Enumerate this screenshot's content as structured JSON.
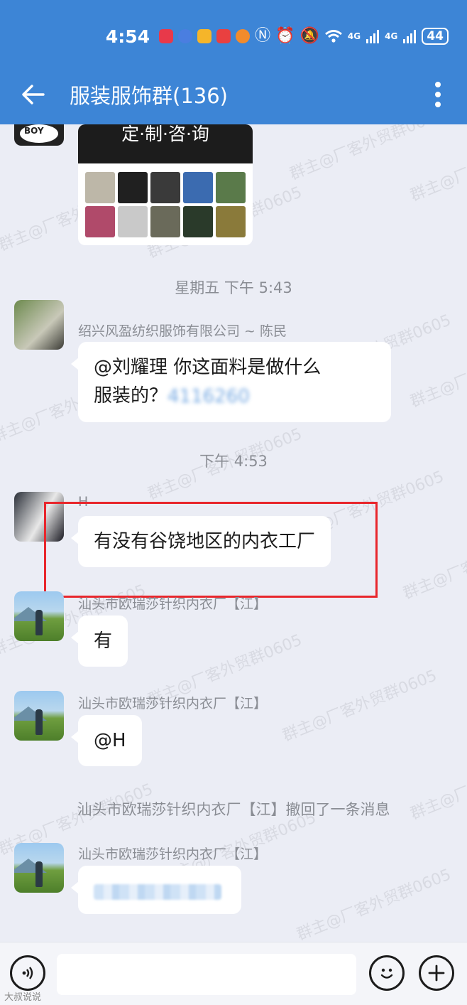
{
  "status_bar": {
    "time": "4:54",
    "network_1": "4G",
    "network_2": "4G",
    "battery": "44"
  },
  "header": {
    "title": "服装服饰群(136)"
  },
  "image_message": {
    "caption": "定·制·咨·询",
    "avatar_text": "BOY"
  },
  "messages": [
    {
      "timestamp": "星期五  下午 5:43",
      "sender": "绍兴风盈纺织服饰有限公司 ~ 陈民",
      "text_line1": "@刘耀理  你这面料是做什么",
      "text_line2": "服装的？",
      "mention_num": "4116260"
    },
    {
      "timestamp": "下午 4:53",
      "sender": "H",
      "text": "有没有谷饶地区的内衣工厂"
    },
    {
      "sender": "汕头市欧瑞莎针织内衣厂【江】",
      "text": "有"
    },
    {
      "sender": "汕头市欧瑞莎针织内衣厂【江】",
      "text": "@H"
    },
    {
      "system": "汕头市欧瑞莎针织内衣厂【江】撤回了一条消息"
    },
    {
      "sender": "汕头市欧瑞莎针织内衣厂【江】",
      "text": ""
    }
  ],
  "watermark": "群主@厂客外贸群0605",
  "input": {
    "placeholder": ""
  },
  "footer": "大叔说说"
}
